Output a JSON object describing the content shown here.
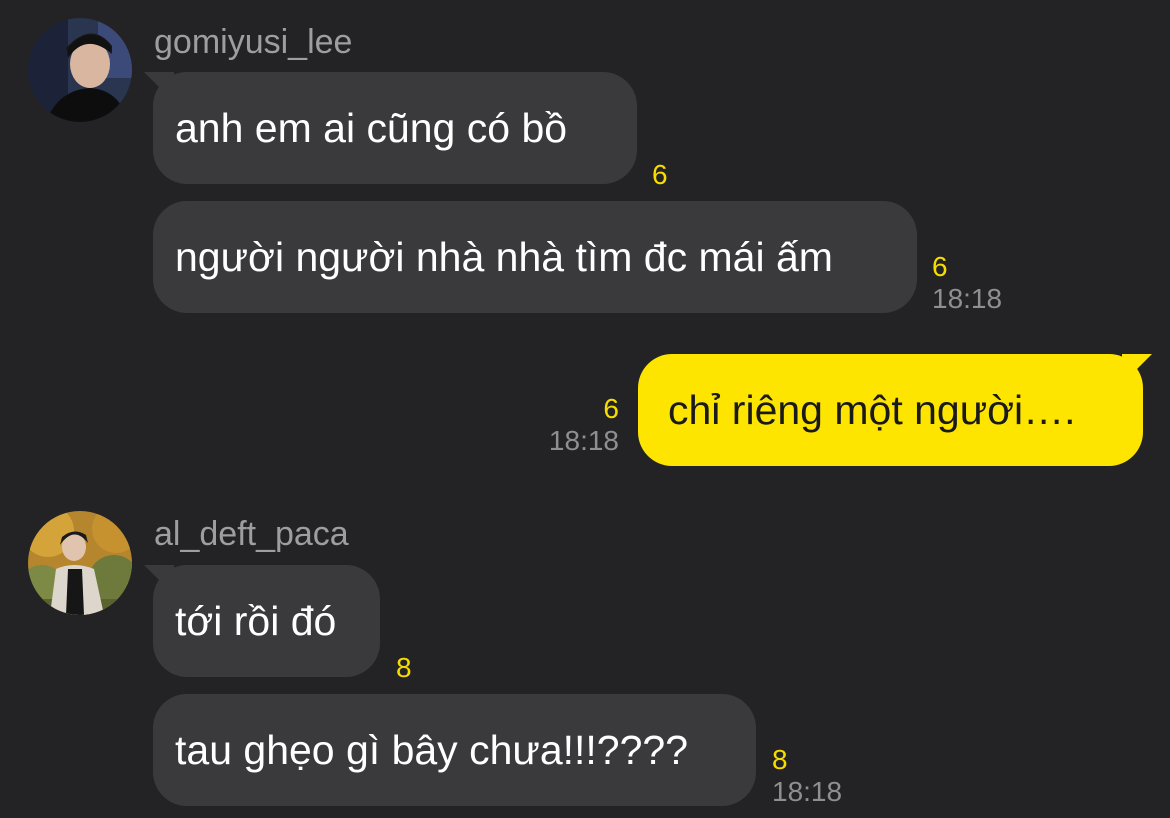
{
  "messages": [
    {
      "sender": "gomiyusi_lee",
      "avatar_icon": "profile-photo-icon",
      "items": [
        {
          "text": "anh em ai cũng có bồ",
          "unread": "6",
          "time": ""
        },
        {
          "text": "người người nhà nhà tìm đc mái ấm",
          "unread": "6",
          "time": "18:18"
        }
      ]
    },
    {
      "sender": "me",
      "items": [
        {
          "text": "chỉ riêng một người….",
          "unread": "6",
          "time": "18:18"
        }
      ]
    },
    {
      "sender": "al_deft_paca",
      "avatar_icon": "profile-photo-icon",
      "items": [
        {
          "text": "tới rồi đó",
          "unread": "8",
          "time": ""
        },
        {
          "text": "tau ghẹo gì bây chưa!!!????",
          "unread": "8",
          "time": "18:18"
        }
      ]
    }
  ],
  "colors": {
    "background": "#232325",
    "incoming_bubble": "#3a3a3c",
    "outgoing_bubble": "#fee500",
    "unread_count": "#f7dc00",
    "timestamp": "#8e8e93",
    "username": "#9d9da2"
  }
}
